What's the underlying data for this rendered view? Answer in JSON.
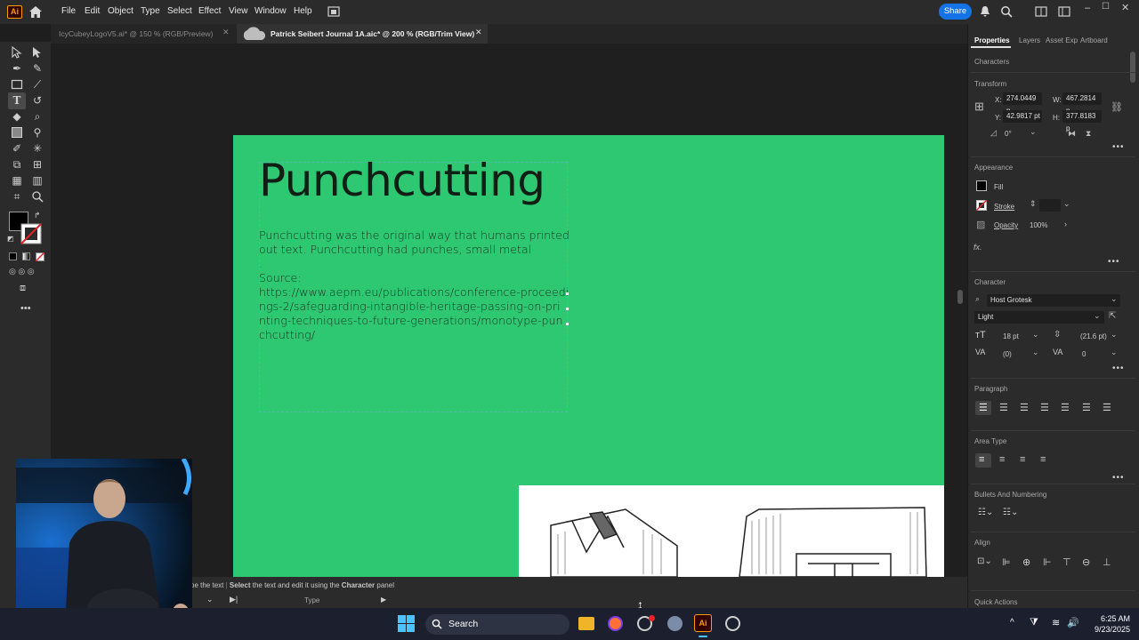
{
  "app": {
    "logo": "Ai",
    "menu": [
      "File",
      "Edit",
      "Object",
      "Type",
      "Select",
      "Effect",
      "View",
      "Window",
      "Help"
    ],
    "share_label": "Share"
  },
  "tabs": [
    {
      "label": "IcyCubeyLogoV5.ai* @ 150 % (RGB/Preview)",
      "active": false
    },
    {
      "label": "Patrick Seibert Journal 1A.aic* @ 200 % (RGB/Trim View)",
      "active": true
    }
  ],
  "artboard": {
    "headline": "Punchcutting",
    "body_lines": [
      "Punchcutting was the original way that humans printed",
      "out text. Punchcutting had punches, small metal",
      ".",
      "Source:",
      "https://www.aepm.eu/publications/conference-proceedi",
      "ngs-2/safeguarding-intangible-heritage-passing-on-pri",
      "nting-techniques-to-future-generations/monotype-pun",
      "chcutting/"
    ],
    "background_color": "#2ec873"
  },
  "properties_panel": {
    "tabs": [
      "Properties",
      "Layers",
      "Asset Exp",
      "Artboard"
    ],
    "selection_label": "Characters",
    "transform": {
      "title": "Transform",
      "x_label": "X:",
      "x_value": "274.0449 p",
      "y_label": "Y:",
      "y_value": "42.9817 pt",
      "w_label": "W:",
      "w_value": "467.2814 p",
      "h_label": "H:",
      "h_value": "377.8183 p",
      "rotation": "0°"
    },
    "appearance": {
      "title": "Appearance",
      "fill_label": "Fill",
      "stroke_label": "Stroke",
      "opacity_label": "Opacity",
      "opacity_value": "100%",
      "fx_label": "fx."
    },
    "character": {
      "title": "Character",
      "font_family": "Host Grotesk",
      "font_style": "Light",
      "font_size": "18 pt",
      "leading": "(21.6 pt)",
      "kerning": "(0)",
      "tracking": "0"
    },
    "paragraph_title": "Paragraph",
    "area_type_title": "Area Type",
    "bullets_title": "Bullets And Numbering",
    "align_title": "Align",
    "quick_actions_title": "Quick Actions"
  },
  "status": {
    "text_prefix": "pe the text",
    "text_select": "Select",
    "text_middle": "the text and edit it using the",
    "text_panel": "Character",
    "text_suffix": "panel",
    "tool_name": "Type"
  },
  "taskbar": {
    "search_label": "Search",
    "time": "6:25 AM",
    "date": "9/23/2025"
  }
}
